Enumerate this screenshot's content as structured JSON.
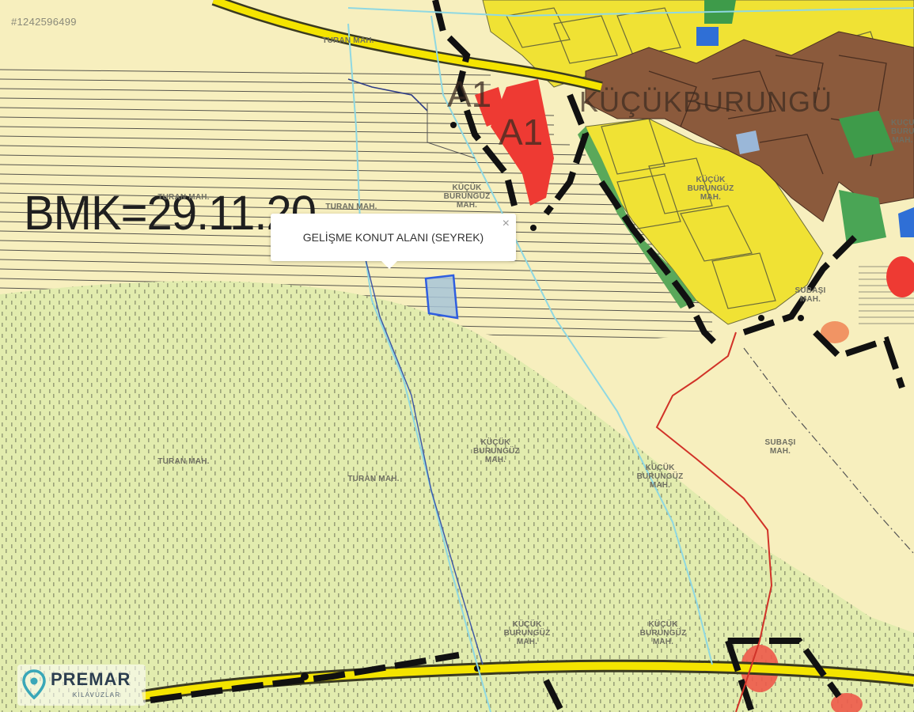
{
  "listing_id": "#1242596499",
  "popup": {
    "text": "GELİŞME KONUT ALANI (SEYREK)",
    "close_icon": "close-icon"
  },
  "map_text": {
    "bmk": "BMK=29.11.20",
    "a1_top": "A1",
    "a1_mid": "A1",
    "district_large": "KÜÇÜKBURUNGÜ"
  },
  "neighborhood_labels": [
    "TURAN MAH.",
    "TURAN MAH.",
    "TURAN MAH.",
    "KÜÇÜK BURUNGÜZ MAH.",
    "KÜÇÜK BURUNGÜZ MAH.",
    "TURAN MAH.",
    "KÜÇÜK BURUNGÜZ MAH.",
    "TURAN MAH.",
    "KÜÇÜK BURUNGÜZ MAH.",
    "SUBAŞI MAH.",
    "SUBAŞI MAH.",
    "KÜÇÜK BURUNGÜZ MAH.",
    "KÜÇÜK BURUNGÜZ MAH.",
    "KÜÇÜK BURUNGÜZ MAH."
  ],
  "logo": {
    "name": "PREMAR",
    "subtitle": "KILAVUZLAR"
  },
  "colors": {
    "residential_low": "#f7efbe",
    "forest_green": "#e4eeb0",
    "residential_yellow": "#f2e43a",
    "brown_zone": "#8a5a3c",
    "red_zone": "#ee3a33",
    "road_yellow": "#f4e400",
    "parcel_blue": "#2f5ee0",
    "boundary_red": "#d13228",
    "waterway_cyan": "#7fd4e0"
  }
}
